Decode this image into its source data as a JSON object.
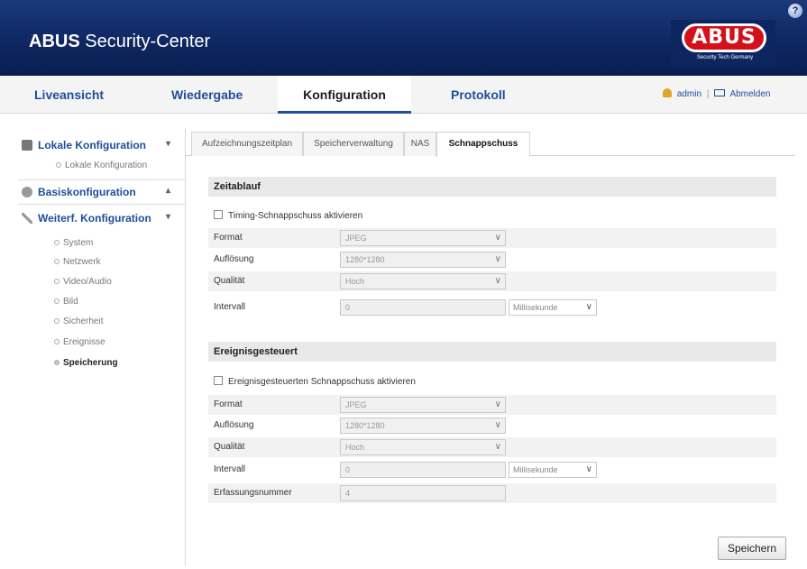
{
  "header": {
    "title_bold": "ABUS",
    "title_rest": " Security-Center",
    "logo_text": "ABUS",
    "logo_sub": "Security Tech Germany",
    "help_symbol": "?"
  },
  "nav": {
    "tabs": [
      {
        "label": "Liveansicht"
      },
      {
        "label": "Wiedergabe"
      },
      {
        "label": "Konfiguration",
        "active": true
      },
      {
        "label": "Protokoll"
      }
    ],
    "user": "admin",
    "divider": "|",
    "logout": "Abmelden"
  },
  "sidebar": {
    "sections": [
      {
        "label": "Lokale Konfiguration",
        "chevron": "▾",
        "icon": "monitor-icon"
      },
      {
        "label": "Basiskonfiguration",
        "chevron": "▴",
        "icon": "gear-icon"
      },
      {
        "label": "Weiterf. Konfiguration",
        "chevron": "▾",
        "icon": "wrench-icon"
      }
    ],
    "lokale_items": [
      "Lokale Konfiguration"
    ],
    "weiterf_items": [
      {
        "label": "System"
      },
      {
        "label": "Netzwerk"
      },
      {
        "label": "Video/Audio"
      },
      {
        "label": "Bild"
      },
      {
        "label": "Sicherheit"
      },
      {
        "label": "Ereignisse"
      },
      {
        "label": "Speicherung",
        "active": true
      }
    ]
  },
  "tabs": [
    {
      "label": "Aufzeichnungszeitplan"
    },
    {
      "label": "Speicherverwaltung"
    },
    {
      "label": "NAS"
    },
    {
      "label": "Schnappschuss",
      "active": true
    }
  ],
  "zeitablauf": {
    "heading": "Zeitablauf",
    "checkbox_label": "Timing-Schnappschuss aktivieren",
    "format_label": "Format",
    "format_value": "JPEG",
    "resolution_label": "Auflösung",
    "resolution_value": "1280*1280",
    "quality_label": "Qualität",
    "quality_value": "Hoch",
    "interval_label": "Intervall",
    "interval_value": "0",
    "interval_unit": "Millisekunde"
  },
  "ereignis": {
    "heading": "Ereignisgesteuert",
    "checkbox_label": "Ereignisgesteuerten Schnappschuss aktivieren",
    "format_label": "Format",
    "format_value": "JPEG",
    "resolution_label": "Auflösung",
    "resolution_value": "1280*1280",
    "quality_label": "Qualität",
    "quality_value": "Hoch",
    "interval_label": "Intervall",
    "interval_value": "0",
    "interval_unit": "Millisekunde",
    "count_label": "Erfassungsnummer",
    "count_value": "4"
  },
  "save_label": "Speichern",
  "arrow": "∨",
  "colors": {
    "header_bg": "#0e2660",
    "accent": "#1e4e9c",
    "logo_red": "#d4111b"
  }
}
